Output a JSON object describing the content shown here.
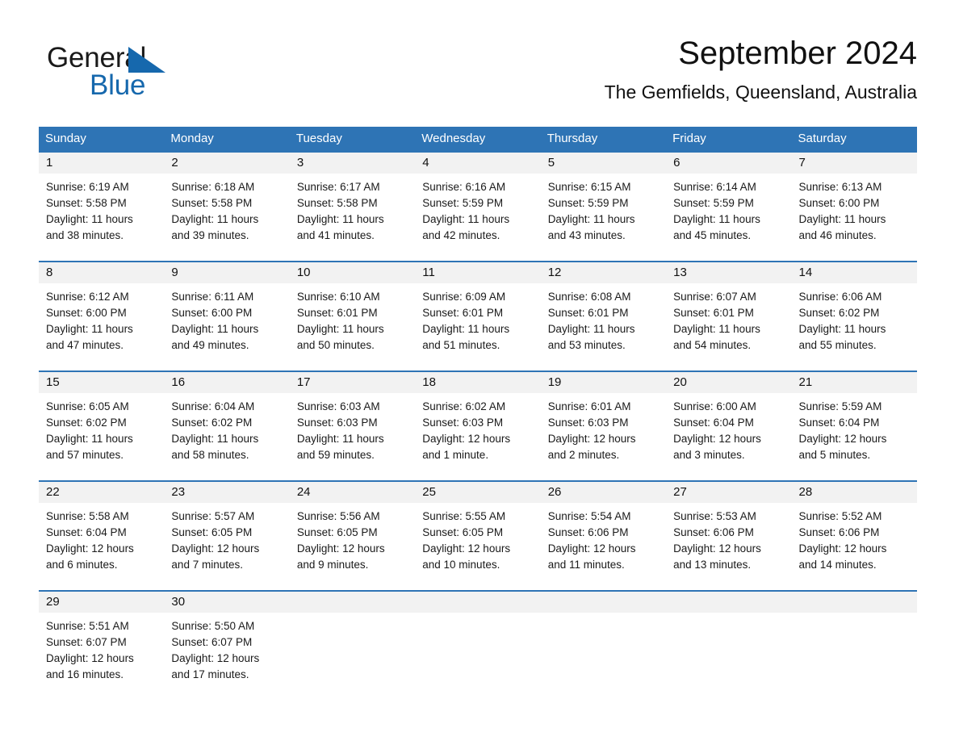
{
  "brand": {
    "name_part1": "General",
    "name_part2": "Blue",
    "triangle_icon": "blue-triangle-icon",
    "accent_color": "#1668ad"
  },
  "header": {
    "title": "September 2024",
    "subtitle": "The Gemfields, Queensland, Australia"
  },
  "theme": {
    "header_blue": "#2e74b5",
    "date_row_gray": "#f2f2f2",
    "text_black": "#1a1a1a"
  },
  "calendar": {
    "weekday_headers": [
      "Sunday",
      "Monday",
      "Tuesday",
      "Wednesday",
      "Thursday",
      "Friday",
      "Saturday"
    ],
    "weeks": [
      {
        "days": [
          {
            "date": "1",
            "sunrise": "Sunrise: 6:19 AM",
            "sunset": "Sunset: 5:58 PM",
            "daylight_line1": "Daylight: 11 hours",
            "daylight_line2": "and 38 minutes."
          },
          {
            "date": "2",
            "sunrise": "Sunrise: 6:18 AM",
            "sunset": "Sunset: 5:58 PM",
            "daylight_line1": "Daylight: 11 hours",
            "daylight_line2": "and 39 minutes."
          },
          {
            "date": "3",
            "sunrise": "Sunrise: 6:17 AM",
            "sunset": "Sunset: 5:58 PM",
            "daylight_line1": "Daylight: 11 hours",
            "daylight_line2": "and 41 minutes."
          },
          {
            "date": "4",
            "sunrise": "Sunrise: 6:16 AM",
            "sunset": "Sunset: 5:59 PM",
            "daylight_line1": "Daylight: 11 hours",
            "daylight_line2": "and 42 minutes."
          },
          {
            "date": "5",
            "sunrise": "Sunrise: 6:15 AM",
            "sunset": "Sunset: 5:59 PM",
            "daylight_line1": "Daylight: 11 hours",
            "daylight_line2": "and 43 minutes."
          },
          {
            "date": "6",
            "sunrise": "Sunrise: 6:14 AM",
            "sunset": "Sunset: 5:59 PM",
            "daylight_line1": "Daylight: 11 hours",
            "daylight_line2": "and 45 minutes."
          },
          {
            "date": "7",
            "sunrise": "Sunrise: 6:13 AM",
            "sunset": "Sunset: 6:00 PM",
            "daylight_line1": "Daylight: 11 hours",
            "daylight_line2": "and 46 minutes."
          }
        ]
      },
      {
        "days": [
          {
            "date": "8",
            "sunrise": "Sunrise: 6:12 AM",
            "sunset": "Sunset: 6:00 PM",
            "daylight_line1": "Daylight: 11 hours",
            "daylight_line2": "and 47 minutes."
          },
          {
            "date": "9",
            "sunrise": "Sunrise: 6:11 AM",
            "sunset": "Sunset: 6:00 PM",
            "daylight_line1": "Daylight: 11 hours",
            "daylight_line2": "and 49 minutes."
          },
          {
            "date": "10",
            "sunrise": "Sunrise: 6:10 AM",
            "sunset": "Sunset: 6:01 PM",
            "daylight_line1": "Daylight: 11 hours",
            "daylight_line2": "and 50 minutes."
          },
          {
            "date": "11",
            "sunrise": "Sunrise: 6:09 AM",
            "sunset": "Sunset: 6:01 PM",
            "daylight_line1": "Daylight: 11 hours",
            "daylight_line2": "and 51 minutes."
          },
          {
            "date": "12",
            "sunrise": "Sunrise: 6:08 AM",
            "sunset": "Sunset: 6:01 PM",
            "daylight_line1": "Daylight: 11 hours",
            "daylight_line2": "and 53 minutes."
          },
          {
            "date": "13",
            "sunrise": "Sunrise: 6:07 AM",
            "sunset": "Sunset: 6:01 PM",
            "daylight_line1": "Daylight: 11 hours",
            "daylight_line2": "and 54 minutes."
          },
          {
            "date": "14",
            "sunrise": "Sunrise: 6:06 AM",
            "sunset": "Sunset: 6:02 PM",
            "daylight_line1": "Daylight: 11 hours",
            "daylight_line2": "and 55 minutes."
          }
        ]
      },
      {
        "days": [
          {
            "date": "15",
            "sunrise": "Sunrise: 6:05 AM",
            "sunset": "Sunset: 6:02 PM",
            "daylight_line1": "Daylight: 11 hours",
            "daylight_line2": "and 57 minutes."
          },
          {
            "date": "16",
            "sunrise": "Sunrise: 6:04 AM",
            "sunset": "Sunset: 6:02 PM",
            "daylight_line1": "Daylight: 11 hours",
            "daylight_line2": "and 58 minutes."
          },
          {
            "date": "17",
            "sunrise": "Sunrise: 6:03 AM",
            "sunset": "Sunset: 6:03 PM",
            "daylight_line1": "Daylight: 11 hours",
            "daylight_line2": "and 59 minutes."
          },
          {
            "date": "18",
            "sunrise": "Sunrise: 6:02 AM",
            "sunset": "Sunset: 6:03 PM",
            "daylight_line1": "Daylight: 12 hours",
            "daylight_line2": "and 1 minute."
          },
          {
            "date": "19",
            "sunrise": "Sunrise: 6:01 AM",
            "sunset": "Sunset: 6:03 PM",
            "daylight_line1": "Daylight: 12 hours",
            "daylight_line2": "and 2 minutes."
          },
          {
            "date": "20",
            "sunrise": "Sunrise: 6:00 AM",
            "sunset": "Sunset: 6:04 PM",
            "daylight_line1": "Daylight: 12 hours",
            "daylight_line2": "and 3 minutes."
          },
          {
            "date": "21",
            "sunrise": "Sunrise: 5:59 AM",
            "sunset": "Sunset: 6:04 PM",
            "daylight_line1": "Daylight: 12 hours",
            "daylight_line2": "and 5 minutes."
          }
        ]
      },
      {
        "days": [
          {
            "date": "22",
            "sunrise": "Sunrise: 5:58 AM",
            "sunset": "Sunset: 6:04 PM",
            "daylight_line1": "Daylight: 12 hours",
            "daylight_line2": "and 6 minutes."
          },
          {
            "date": "23",
            "sunrise": "Sunrise: 5:57 AM",
            "sunset": "Sunset: 6:05 PM",
            "daylight_line1": "Daylight: 12 hours",
            "daylight_line2": "and 7 minutes."
          },
          {
            "date": "24",
            "sunrise": "Sunrise: 5:56 AM",
            "sunset": "Sunset: 6:05 PM",
            "daylight_line1": "Daylight: 12 hours",
            "daylight_line2": "and 9 minutes."
          },
          {
            "date": "25",
            "sunrise": "Sunrise: 5:55 AM",
            "sunset": "Sunset: 6:05 PM",
            "daylight_line1": "Daylight: 12 hours",
            "daylight_line2": "and 10 minutes."
          },
          {
            "date": "26",
            "sunrise": "Sunrise: 5:54 AM",
            "sunset": "Sunset: 6:06 PM",
            "daylight_line1": "Daylight: 12 hours",
            "daylight_line2": "and 11 minutes."
          },
          {
            "date": "27",
            "sunrise": "Sunrise: 5:53 AM",
            "sunset": "Sunset: 6:06 PM",
            "daylight_line1": "Daylight: 12 hours",
            "daylight_line2": "and 13 minutes."
          },
          {
            "date": "28",
            "sunrise": "Sunrise: 5:52 AM",
            "sunset": "Sunset: 6:06 PM",
            "daylight_line1": "Daylight: 12 hours",
            "daylight_line2": "and 14 minutes."
          }
        ]
      },
      {
        "days": [
          {
            "date": "29",
            "sunrise": "Sunrise: 5:51 AM",
            "sunset": "Sunset: 6:07 PM",
            "daylight_line1": "Daylight: 12 hours",
            "daylight_line2": "and 16 minutes."
          },
          {
            "date": "30",
            "sunrise": "Sunrise: 5:50 AM",
            "sunset": "Sunset: 6:07 PM",
            "daylight_line1": "Daylight: 12 hours",
            "daylight_line2": "and 17 minutes."
          },
          {
            "date": "",
            "sunrise": "",
            "sunset": "",
            "daylight_line1": "",
            "daylight_line2": ""
          },
          {
            "date": "",
            "sunrise": "",
            "sunset": "",
            "daylight_line1": "",
            "daylight_line2": ""
          },
          {
            "date": "",
            "sunrise": "",
            "sunset": "",
            "daylight_line1": "",
            "daylight_line2": ""
          },
          {
            "date": "",
            "sunrise": "",
            "sunset": "",
            "daylight_line1": "",
            "daylight_line2": ""
          },
          {
            "date": "",
            "sunrise": "",
            "sunset": "",
            "daylight_line1": "",
            "daylight_line2": ""
          }
        ]
      }
    ]
  }
}
